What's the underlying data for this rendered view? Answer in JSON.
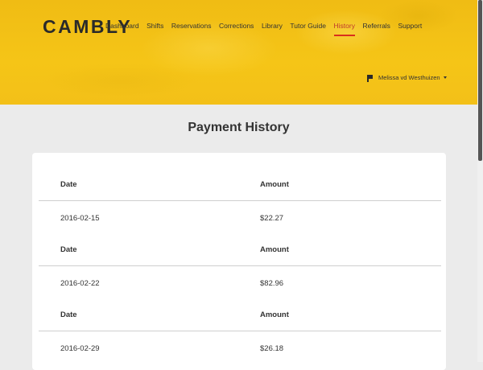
{
  "brand": {
    "logo_text": "CAMBLY"
  },
  "nav": {
    "items": [
      {
        "label": "Dashboard",
        "active": false
      },
      {
        "label": "Shifts",
        "active": false
      },
      {
        "label": "Reservations",
        "active": false
      },
      {
        "label": "Corrections",
        "active": false
      },
      {
        "label": "Library",
        "active": false
      },
      {
        "label": "Tutor Guide",
        "active": false
      },
      {
        "label": "History",
        "active": true
      },
      {
        "label": "Referrals",
        "active": false
      },
      {
        "label": "Support",
        "active": false
      }
    ],
    "active_color": "#d9301c"
  },
  "user": {
    "name": "Melissa vd Westhuizen",
    "icons": [
      "flag-icon",
      "caret-down-icon"
    ]
  },
  "page": {
    "title": "Payment History"
  },
  "payments": {
    "header": {
      "date": "Date",
      "amount": "Amount"
    },
    "rows": [
      {
        "date": "2016-02-15",
        "amount": "$22.27"
      },
      {
        "date": "2016-02-22",
        "amount": "$82.96"
      },
      {
        "date": "2016-02-29",
        "amount": "$26.18"
      }
    ]
  },
  "colors": {
    "header_bg": "#f5c517",
    "page_bg": "#ebebeb",
    "card_bg": "#ffffff"
  }
}
